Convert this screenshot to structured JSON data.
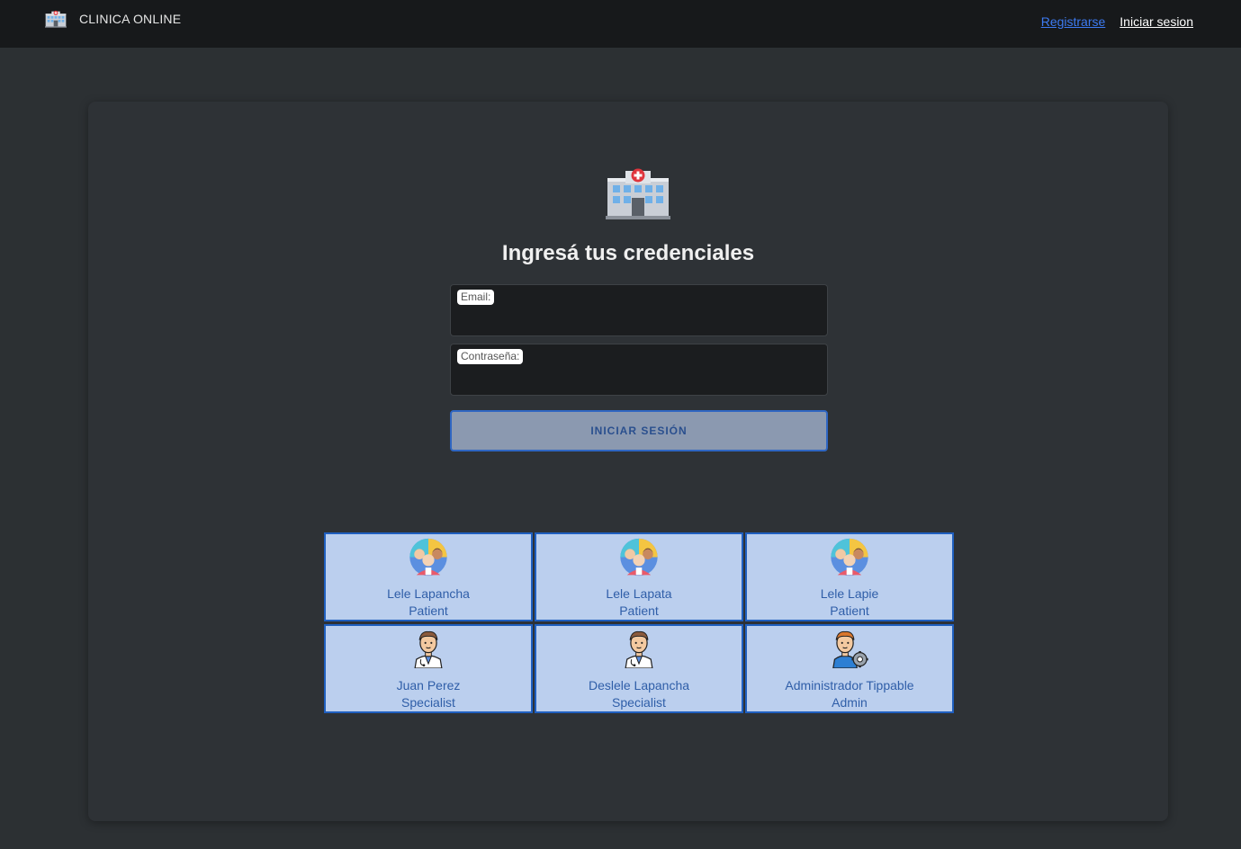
{
  "navbar": {
    "brand_title": "CLINICA ONLINE",
    "brand_icon": "hospital-icon",
    "links": {
      "register": "Registrarse",
      "login": "Iniciar sesion"
    }
  },
  "login_form": {
    "hero_icon": "hospital-icon",
    "title": "Ingresá tus credenciales",
    "email_label": "Email:",
    "email_value": "",
    "password_label": "Contraseña:",
    "password_value": "",
    "submit_label": "INICIAR SESIÓN"
  },
  "quick_access": {
    "users": [
      {
        "name": "Lele Lapancha",
        "role": "Patient",
        "avatar": "patient-group-icon"
      },
      {
        "name": "Lele Lapata",
        "role": "Patient",
        "avatar": "patient-group-icon"
      },
      {
        "name": "Lele Lapie",
        "role": "Patient",
        "avatar": "patient-group-icon"
      },
      {
        "name": "Juan Perez",
        "role": "Specialist",
        "avatar": "doctor-icon"
      },
      {
        "name": "Deslele Lapancha",
        "role": "Specialist",
        "avatar": "doctor-icon"
      },
      {
        "name": "Administrador Tippable",
        "role": "Admin",
        "avatar": "admin-gear-icon"
      }
    ]
  },
  "colors": {
    "navbar_bg": "#17191b",
    "page_bg": "#2c3033",
    "card_bg": "#2e3236",
    "link_blue": "#3d7bf2",
    "tile_bg": "#bbcfee",
    "tile_border": "#1f5fbf",
    "button_bg": "#8b99b0"
  }
}
